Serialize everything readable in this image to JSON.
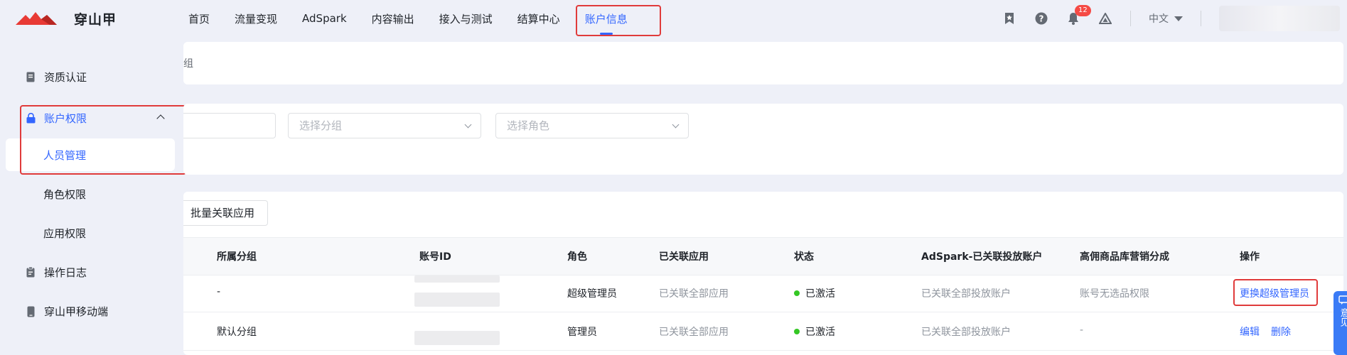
{
  "app": {
    "name": "穿山甲"
  },
  "nav": {
    "items": [
      "首页",
      "流量变现",
      "AdSpark",
      "内容输出",
      "接入与测试",
      "结算中心",
      "账户信息"
    ]
  },
  "header": {
    "notification_count": "12",
    "language": "中文"
  },
  "sidebar": {
    "items": [
      {
        "label": "资质认证",
        "icon": "document-icon"
      },
      {
        "label": "账户权限",
        "icon": "lock-icon"
      },
      {
        "label": "人员管理"
      },
      {
        "label": "角色权限"
      },
      {
        "label": "应用权限"
      },
      {
        "label": "操作日志",
        "icon": "clipboard-icon"
      },
      {
        "label": "穿山甲移动端",
        "icon": "mobile-icon"
      }
    ]
  },
  "breadcrumb": {
    "text": "组"
  },
  "filters": {
    "group_placeholder": "选择分组",
    "role_placeholder": "选择角色"
  },
  "toolbar": {
    "batch_button": "批量关联应用"
  },
  "table": {
    "headers": [
      "所属分组",
      "账号ID",
      "角色",
      "已关联应用",
      "状态",
      "AdSpark-已关联投放账户",
      "高佣商品库营销分成",
      "操作"
    ],
    "rows": [
      {
        "group": "-",
        "role": "超级管理员",
        "apps": "已关联全部应用",
        "status": "已激活",
        "adspark": "已关联全部投放账户",
        "commission": "账号无选品权限",
        "action": "更换超级管理员"
      },
      {
        "group": "默认分组",
        "role": "管理员",
        "apps": "已关联全部应用",
        "status": "已激活",
        "adspark": "已关联全部投放账户",
        "commission": "-",
        "action_edit": "编辑",
        "action_delete": "删除"
      }
    ]
  },
  "float": {
    "text": "意见"
  },
  "colors": {
    "accent": "#3366ff",
    "highlight": "#e03b3b",
    "active_dot": "#34c724"
  }
}
